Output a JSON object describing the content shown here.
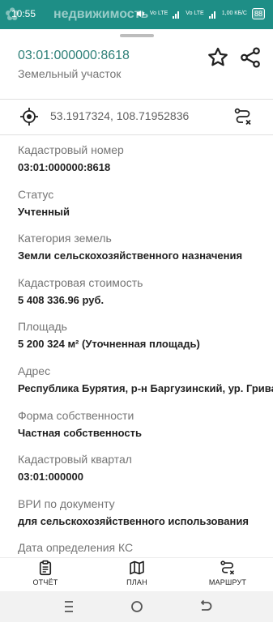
{
  "status_bar": {
    "time": "10:55",
    "app_title": "недвижимость",
    "signal_text_1": "Vo LTE",
    "signal_text_2": "Vo LTE",
    "speed": "1,00 КБ/С",
    "battery": "88"
  },
  "header": {
    "cadastral_number": "03:01:000000:8618",
    "object_type": "Земельный участок"
  },
  "coordinates": {
    "text": "53.1917324, 108.71952836"
  },
  "fields": [
    {
      "label": "Кадастровый номер",
      "value": "03:01:000000:8618"
    },
    {
      "label": "Статус",
      "value": "Учтенный"
    },
    {
      "label": "Категория земель",
      "value": "Земли сельскохозяйственного назначения"
    },
    {
      "label": "Кадастровая стоимость",
      "value": "5 408 336.96 руб."
    },
    {
      "label": "Площадь",
      "value": "5 200 324 м² (Уточненная площадь)"
    },
    {
      "label": "Адрес",
      "value": "Республика Бурятия, р-н Баргузинский, ур. Грива"
    },
    {
      "label": "Форма собственности",
      "value": "Частная собственность"
    },
    {
      "label": "Кадастровый квартал",
      "value": "03:01:000000"
    },
    {
      "label": "ВРИ по документу",
      "value": "для сельскохозяйственного использования"
    },
    {
      "label": "Дата определения КС",
      "value": ""
    }
  ],
  "bottom_nav": {
    "report": "ОТЧЁТ",
    "plan": "ПЛАН",
    "route": "МАРШРУТ"
  },
  "colors": {
    "accent": "#2d7f77",
    "status_bar": "#1e8e86"
  }
}
